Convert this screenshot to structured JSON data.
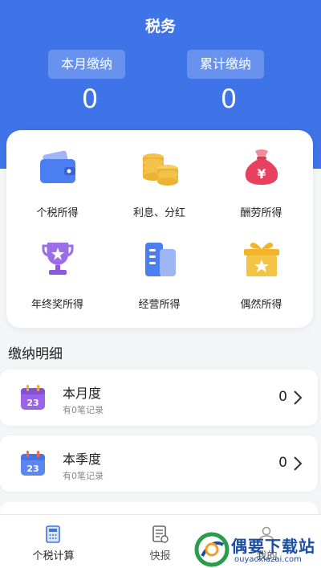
{
  "header": {
    "title": "税务",
    "month_label": "本月缴纳",
    "month_value": "0",
    "total_label": "累计缴纳",
    "total_value": "0",
    "bg_color": "#3e74e8"
  },
  "grid": {
    "items": [
      {
        "label": "个税所得",
        "icon": "wallet-icon"
      },
      {
        "label": "利息、分红",
        "icon": "coins-icon"
      },
      {
        "label": "酬劳所得",
        "icon": "money-bag-icon"
      },
      {
        "label": "年终奖所得",
        "icon": "trophy-icon"
      },
      {
        "label": "经营所得",
        "icon": "buildings-icon"
      },
      {
        "label": "偶然所得",
        "icon": "gift-icon"
      }
    ]
  },
  "details": {
    "title": "缴纳明细",
    "records": [
      {
        "title": "本月度",
        "subtitle": "有0笔记录",
        "value": "0",
        "icon": "calendar-icon",
        "calendar_day": "23",
        "icon_color": "#9b63e8"
      },
      {
        "title": "本季度",
        "subtitle": "有0笔记录",
        "value": "0",
        "icon": "calendar-icon",
        "calendar_day": "23",
        "icon_color": "#5c86f0"
      }
    ]
  },
  "nav": {
    "items": [
      {
        "label": "个税计算",
        "icon": "calculator-icon"
      },
      {
        "label": "快报",
        "icon": "report-icon"
      },
      {
        "label": "我的",
        "icon": "user-icon"
      }
    ]
  },
  "watermark": {
    "text": "偶要下载站",
    "url": "ouyaoxiazai.com"
  }
}
